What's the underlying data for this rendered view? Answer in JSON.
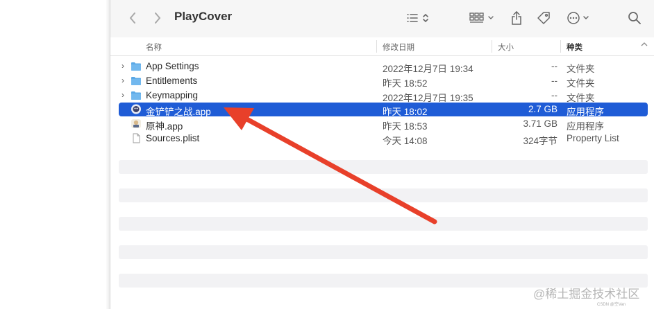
{
  "window": {
    "title": "PlayCover"
  },
  "toolbar": {
    "icons": [
      "chevron-left-icon",
      "chevron-right-icon",
      "list-view-icon",
      "grid-view-icon",
      "share-icon",
      "tag-icon",
      "more-icon",
      "search-icon"
    ]
  },
  "columns": {
    "name": "名称",
    "date": "修改日期",
    "size": "大小",
    "kind": "种类"
  },
  "files": [
    {
      "name": "App Settings",
      "date": "2022年12月7日 19:34",
      "size": "--",
      "kind": "文件夹",
      "type": "folder",
      "expandable": true,
      "selected": false
    },
    {
      "name": "Entitlements",
      "date": "昨天 18:52",
      "size": "--",
      "kind": "文件夹",
      "type": "folder",
      "expandable": true,
      "selected": false
    },
    {
      "name": "Keymapping",
      "date": "2022年12月7日 19:35",
      "size": "--",
      "kind": "文件夹",
      "type": "folder",
      "expandable": true,
      "selected": false
    },
    {
      "name": "金铲铲之战.app",
      "date": "昨天 18:02",
      "size": "2.7 GB",
      "kind": "应用程序",
      "type": "app",
      "expandable": false,
      "selected": true
    },
    {
      "name": "原神.app",
      "date": "昨天 18:53",
      "size": "3.71 GB",
      "kind": "应用程序",
      "type": "app",
      "expandable": false,
      "selected": false
    },
    {
      "name": "Sources.plist",
      "date": "今天 14:08",
      "size": "324字节",
      "kind": "Property List",
      "type": "plist",
      "expandable": false,
      "selected": false
    }
  ],
  "watermark": {
    "text": "@稀土掘金技术社区",
    "sub": "CSDN @空Van"
  },
  "colors": {
    "selection": "#1f5cd6",
    "folder": "#5aa8e6",
    "arrow": "#e8402a"
  }
}
